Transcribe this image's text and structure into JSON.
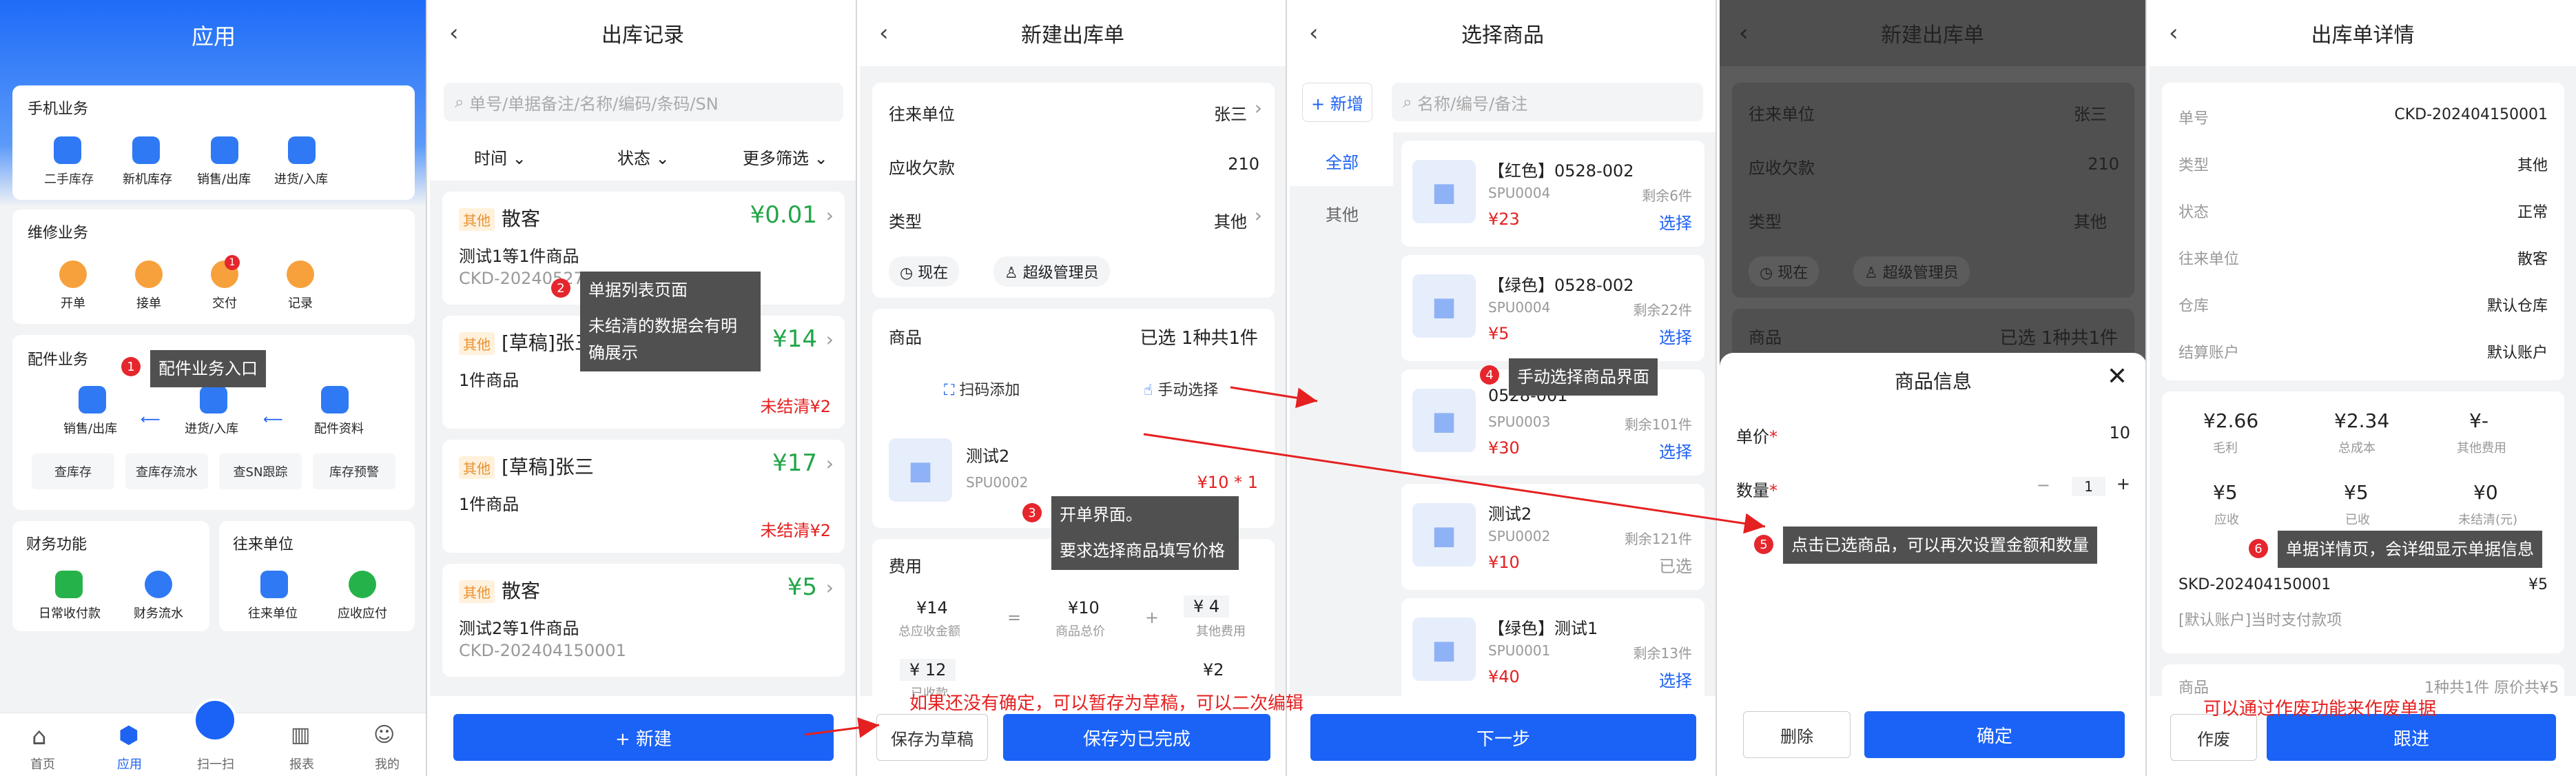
{
  "p1": {
    "title": "应用",
    "mobile": {
      "title": "手机业务",
      "items": [
        "二手库存",
        "新机库存",
        "销售/出库",
        "进货/入库"
      ]
    },
    "repair": {
      "title": "维修业务",
      "items": [
        "开单",
        "接单",
        "交付",
        "记录"
      ],
      "badge": "1"
    },
    "parts": {
      "title": "配件业务",
      "items": [
        "销售/出库",
        "进货/入库",
        "配件资料"
      ],
      "buttons": [
        "查库存",
        "查库存流水",
        "查SN跟踪",
        "库存预警"
      ]
    },
    "finance": {
      "title": "财务功能",
      "items": [
        "日常收付款",
        "财务流水"
      ]
    },
    "partners": {
      "title": "往来单位",
      "items": [
        "往来单位",
        "应收应付"
      ]
    },
    "tabbar": [
      "首页",
      "应用",
      "扫一扫",
      "报表",
      "我的"
    ]
  },
  "p2": {
    "title": "出库记录",
    "search": "单号/单据备注/名称/编码/条码/SN",
    "filters": [
      "时间",
      "状态",
      "更多筛选"
    ],
    "orders": [
      {
        "tag": "其他",
        "name": "散客",
        "amount": "¥0.01",
        "desc": "测试1等1件商品",
        "code": "CKD-202405270001"
      },
      {
        "tag": "其他",
        "name": "[草稿]张三",
        "amount": "¥14",
        "desc": "1件商品",
        "status": "未结清¥2"
      },
      {
        "tag": "其他",
        "name": "[草稿]张三",
        "amount": "¥17",
        "desc": "1件商品",
        "status": "未结清¥2"
      },
      {
        "tag": "其他",
        "name": "散客",
        "amount": "¥5",
        "desc": "测试2等1件商品",
        "code": "CKD-202404150001"
      }
    ],
    "new_btn": "+ 新建"
  },
  "p3": {
    "title": "新建出库单",
    "rows": [
      {
        "label": "往来单位",
        "value": "张三"
      },
      {
        "label": "应收欠款",
        "value": "210"
      },
      {
        "label": "类型",
        "value": "其他"
      }
    ],
    "now": "现在",
    "user": "超级管理员",
    "goods_label": "商品",
    "goods_summary": "已选 1种共1件",
    "scan": "扫码添加",
    "manual": "手动选择",
    "item": {
      "name": "测试2",
      "spu": "SPU0002",
      "price": "¥10 * 1"
    },
    "fee": {
      "title": "费用",
      "total": "¥14",
      "total_label": "总应收金额",
      "eq": "=",
      "goods": "¥10",
      "goods_label": "商品总价",
      "plus": "+",
      "other": "¥ 4",
      "other_label": "其他费用",
      "paid": "¥ 12",
      "paid_label": "已收款",
      "unpaid": "¥2"
    },
    "draft_btn": "保存为草稿",
    "done_btn": "保存为已完成"
  },
  "p4": {
    "title": "选择商品",
    "new": "+ 新增",
    "search": "名称/编号/备注",
    "cats": [
      "全部",
      "其他"
    ],
    "products": [
      {
        "name": "【红色】0528-002",
        "spu": "SPU0004",
        "stock": "剩余6件",
        "price": "¥23",
        "action": "选择"
      },
      {
        "name": "【绿色】0528-002",
        "spu": "SPU0004",
        "stock": "剩余22件",
        "price": "¥5",
        "action": "选择"
      },
      {
        "name": "0528-001",
        "spu": "SPU0003",
        "stock": "剩余101件",
        "price": "¥30",
        "action": "选择"
      },
      {
        "name": "测试2",
        "spu": "SPU0002",
        "stock": "剩余121件",
        "price": "¥10",
        "action": "已选"
      },
      {
        "name": "【绿色】测试1",
        "spu": "SPU0001",
        "stock": "剩余13件",
        "price": "¥40",
        "action": "选择"
      }
    ],
    "next": "下一步"
  },
  "p5": {
    "title": "新建出库单",
    "modal_title": "商品信息",
    "price_label": "单价",
    "price_val": "10",
    "qty_label": "数量",
    "qty_val": "1",
    "minus": "−",
    "plus": "+",
    "del": "删除",
    "ok": "确定"
  },
  "p6": {
    "title": "出库单详情",
    "rows": [
      {
        "label": "单号",
        "value": "CKD-202404150001"
      },
      {
        "label": "类型",
        "value": "其他"
      },
      {
        "label": "状态",
        "value": "正常"
      },
      {
        "label": "往来单位",
        "value": "散客"
      },
      {
        "label": "仓库",
        "value": "默认仓库"
      },
      {
        "label": "结算账户",
        "value": "默认账户"
      }
    ],
    "stats": [
      {
        "v": "¥2.66",
        "l": "毛利"
      },
      {
        "v": "¥2.34",
        "l": "总成本"
      },
      {
        "v": "¥-",
        "l": "其他费用"
      },
      {
        "v": "¥5",
        "l": "应收"
      },
      {
        "v": "¥5",
        "l": "已收"
      },
      {
        "v": "¥0",
        "l": "未结清(元)"
      }
    ],
    "sub_code": "SKD-202404150001",
    "sub_amount": "¥5",
    "sub_note": "[默认账户]当时支付款项",
    "goods_label": "商品",
    "goods_summary": "1种共1件 原价共¥5",
    "void_btn": "作废",
    "follow_btn": "跟进"
  },
  "ann": {
    "a1": "配件业务入口",
    "a2a": "单据列表页面",
    "a2b": "未结清的数据会有明确展示",
    "a3a": "开单界面。",
    "a3b": "要求选择商品填写价格",
    "a4": "手动选择商品界面",
    "a5": "点击已选商品，可以再次设置金额和数量",
    "a6": "单据详情页，会详细显示单据信息",
    "draft": "如果还没有确定，可以暂存为草稿，可以二次编辑",
    "void": "可以通过作废功能来作废单据",
    "n": [
      "1",
      "2",
      "3",
      "4",
      "5",
      "6"
    ]
  },
  "colors": {
    "primary": "#1b63f6",
    "green": "#22a548",
    "red": "#e52020",
    "tag_bg": "#fff1dc"
  }
}
